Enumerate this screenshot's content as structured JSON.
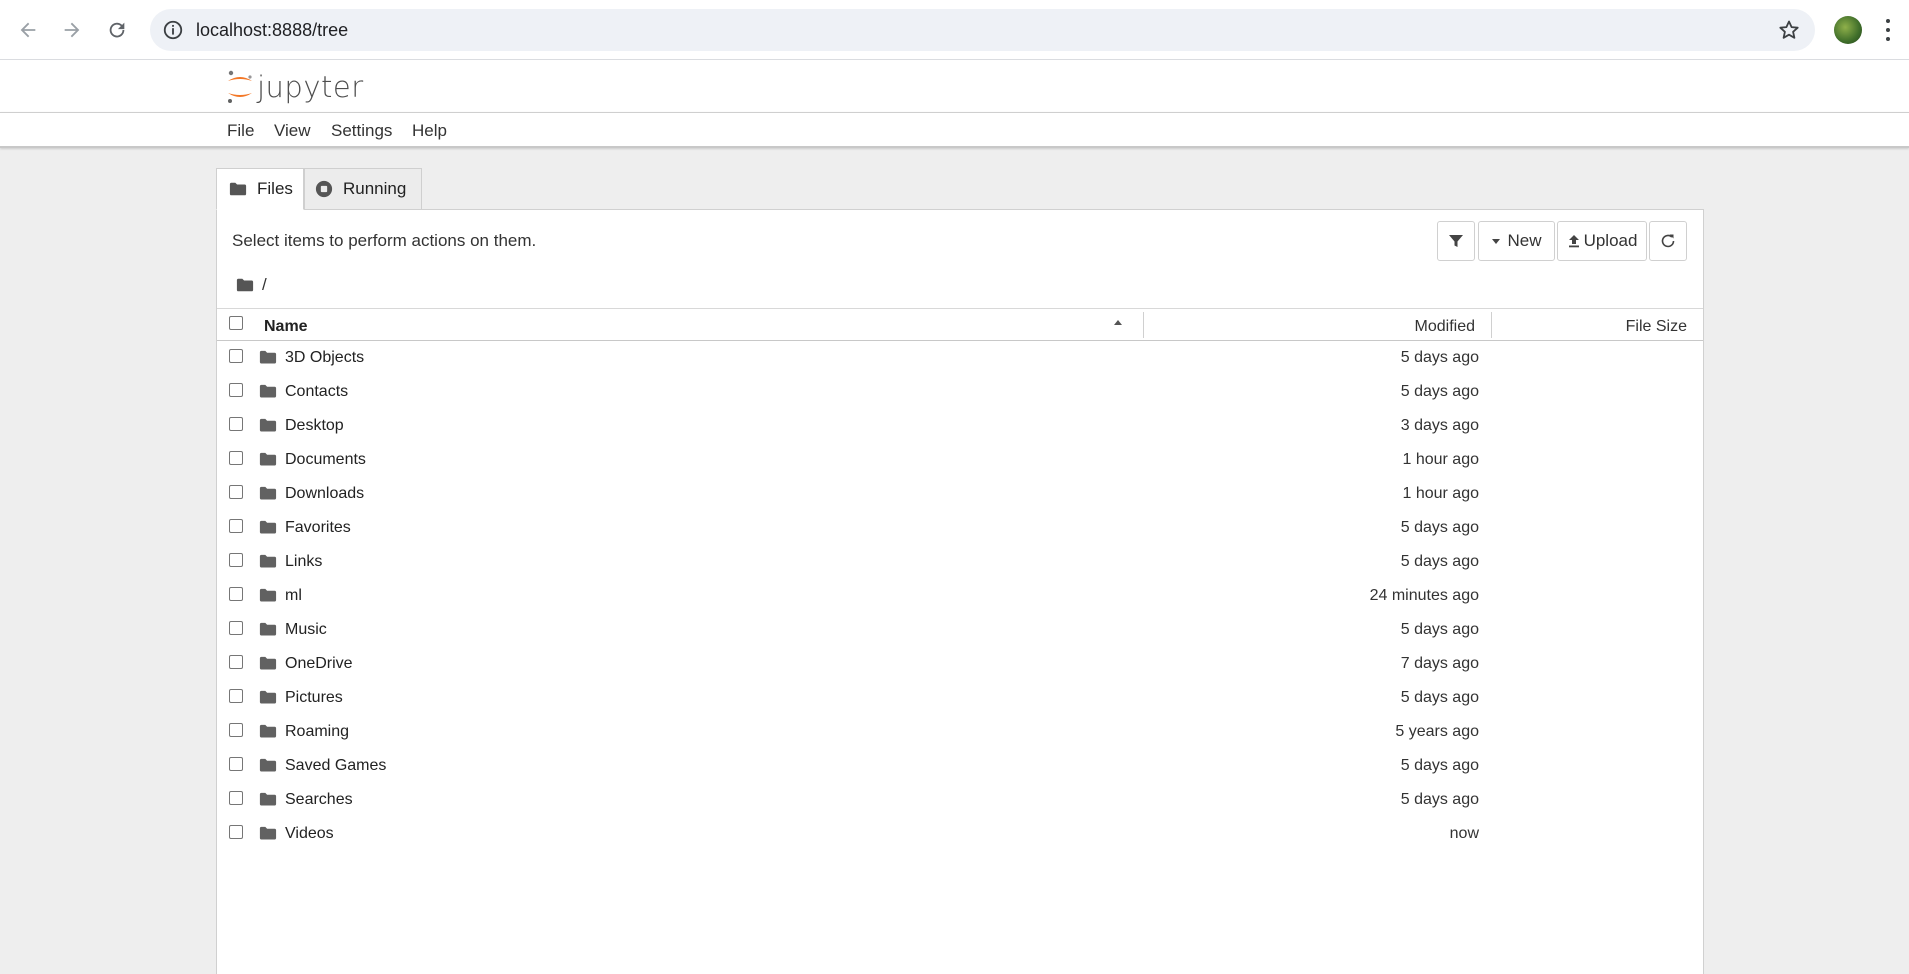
{
  "browser": {
    "url": "localhost:8888/tree"
  },
  "header": {
    "logo_text": "jupyter",
    "menu": [
      "File",
      "View",
      "Settings",
      "Help"
    ]
  },
  "tabs": [
    {
      "label": "Files",
      "active": true
    },
    {
      "label": "Running",
      "active": false
    }
  ],
  "panel": {
    "select_message": "Select items to perform actions on them.",
    "toolbar": {
      "new_label": "New",
      "upload_label": "Upload"
    },
    "breadcrumb": "/"
  },
  "table": {
    "headers": {
      "name": "Name",
      "modified": "Modified",
      "size": "File Size"
    },
    "rows": [
      {
        "name": "3D Objects",
        "modified": "5 days ago"
      },
      {
        "name": "Contacts",
        "modified": "5 days ago"
      },
      {
        "name": "Desktop",
        "modified": "3 days ago"
      },
      {
        "name": "Documents",
        "modified": "1 hour ago"
      },
      {
        "name": "Downloads",
        "modified": "1 hour ago"
      },
      {
        "name": "Favorites",
        "modified": "5 days ago"
      },
      {
        "name": "Links",
        "modified": "5 days ago"
      },
      {
        "name": "ml",
        "modified": "24 minutes ago"
      },
      {
        "name": "Music",
        "modified": "5 days ago"
      },
      {
        "name": "OneDrive",
        "modified": "7 days ago"
      },
      {
        "name": "Pictures",
        "modified": "5 days ago"
      },
      {
        "name": "Roaming",
        "modified": "5 years ago"
      },
      {
        "name": "Saved Games",
        "modified": "5 days ago"
      },
      {
        "name": "Searches",
        "modified": "5 days ago"
      },
      {
        "name": "Videos",
        "modified": "now"
      }
    ]
  },
  "colors": {
    "jupyter_orange": "#f37726",
    "page_background": "#eeeeee",
    "omnibox_background": "#eef1f6"
  },
  "icons": [
    "back-arrow-icon",
    "forward-arrow-icon",
    "reload-icon",
    "info-icon",
    "star-icon",
    "folder-icon",
    "running-icon",
    "filter-icon",
    "caret-down-icon",
    "upload-icon",
    "refresh-icon",
    "sort-ascending-icon"
  ]
}
